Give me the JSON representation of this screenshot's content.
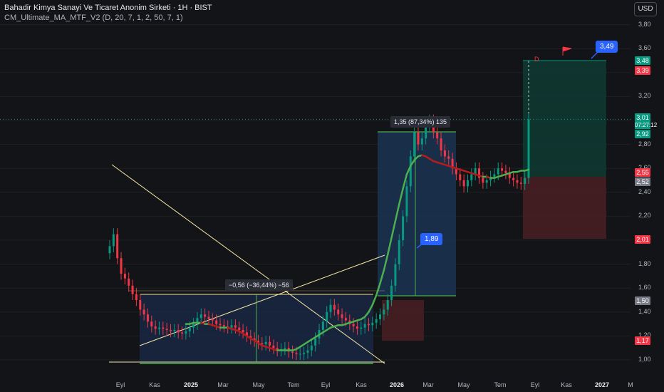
{
  "header": {
    "title": "Bahadir Kimya Sanayi Ve Ticaret Anonim Sirketi · 1H · BIST",
    "indicator": "CM_Ultimate_MA_MTF_V2 (D, 20, 7, 1, 2, 50, 7, 1)"
  },
  "currency": "USD",
  "price_tags": [
    {
      "value": "3,48",
      "color": "#089981"
    },
    {
      "value": "3,39",
      "color": "#f23645"
    },
    {
      "value": "3,01",
      "color": "#089981"
    },
    {
      "value": "2,92",
      "color": "#089981"
    },
    {
      "value": "2,55",
      "color": "#f23645"
    },
    {
      "value": "2,52",
      "color": "#787b86"
    },
    {
      "value": "2,01",
      "color": "#f23645"
    },
    {
      "value": "1,50",
      "color": "#787b86"
    },
    {
      "value": "1,17",
      "color": "#f23645"
    }
  ],
  "countdown": "07:27:12",
  "measure_labels": {
    "drop": "−0,56 (−36,44%) −56",
    "rise": "1,35 (87,34%) 135"
  },
  "callouts": {
    "low": "1,89",
    "high": "3,49"
  },
  "marker_d": "D",
  "colors": {
    "up": "#089981",
    "down": "#f23645",
    "ma_up": "#4caf50",
    "ma_down": "#b71c1c",
    "box_fill": "#1b2a4a",
    "line_yellow": "#f5e6a6"
  },
  "chart_data": {
    "type": "candlestick",
    "y_ticks": [
      "3,80",
      "3,60",
      "3,40",
      "3,20",
      "3,00",
      "2,80",
      "2,60",
      "2,40",
      "2,20",
      "2,00",
      "1,80",
      "1,60",
      "1,40",
      "1,20",
      "1,00"
    ],
    "ylim": [
      0.96,
      3.84
    ],
    "x_ticks": [
      {
        "label": "Eyl",
        "bold": false
      },
      {
        "label": "Kas",
        "bold": false
      },
      {
        "label": "2025",
        "bold": true
      },
      {
        "label": "Mar",
        "bold": false
      },
      {
        "label": "May",
        "bold": false
      },
      {
        "label": "Tem",
        "bold": false
      },
      {
        "label": "Eyl",
        "bold": false
      },
      {
        "label": "Kas",
        "bold": false
      },
      {
        "label": "2026",
        "bold": true
      },
      {
        "label": "Mar",
        "bold": false
      },
      {
        "label": "May",
        "bold": false
      },
      {
        "label": "Tem",
        "bold": false
      },
      {
        "label": "Eyl",
        "bold": false
      },
      {
        "label": "Kas",
        "bold": false
      },
      {
        "label": "2027",
        "bold": true
      },
      {
        "label": "M",
        "bold": false
      }
    ],
    "last_price": 3.01,
    "closes": [
      1.95,
      2.05,
      1.85,
      1.72,
      1.68,
      1.62,
      1.55,
      1.5,
      1.42,
      1.38,
      1.32,
      1.28,
      1.26,
      1.27,
      1.26,
      1.25,
      1.24,
      1.25,
      1.23,
      1.22,
      1.24,
      1.27,
      1.3,
      1.35,
      1.38,
      1.36,
      1.34,
      1.33,
      1.3,
      1.29,
      1.28,
      1.27,
      1.29,
      1.27,
      1.25,
      1.23,
      1.2,
      1.18,
      1.16,
      1.14,
      1.13,
      1.15,
      1.12,
      1.1,
      1.08,
      1.09,
      1.1,
      1.07,
      1.06,
      1.05,
      1.05,
      1.06,
      1.08,
      1.12,
      1.18,
      1.25,
      1.32,
      1.4,
      1.46,
      1.42,
      1.38,
      1.35,
      1.33,
      1.3,
      1.28,
      1.26,
      1.27,
      1.3,
      1.29,
      1.31,
      1.34,
      1.38,
      1.42,
      1.5,
      1.62,
      1.8,
      2.0,
      2.2,
      2.45,
      2.7,
      2.9,
      2.8,
      2.85,
      2.95,
      3.0,
      2.9,
      2.85,
      2.75,
      2.7,
      2.68,
      2.6,
      2.55,
      2.5,
      2.45,
      2.5,
      2.55,
      2.6,
      2.52,
      2.48,
      2.5,
      2.53,
      2.55,
      2.6,
      2.58,
      2.56,
      2.52,
      2.5,
      2.48,
      2.47,
      2.52,
      3.01
    ],
    "ma": [
      null,
      null,
      null,
      null,
      null,
      null,
      null,
      null,
      null,
      null,
      null,
      null,
      null,
      null,
      null,
      null,
      null,
      null,
      null,
      null,
      1.3,
      1.3,
      1.31,
      1.31,
      1.31,
      1.3,
      1.3,
      1.29,
      1.28,
      1.27,
      1.27,
      1.27,
      1.26,
      1.25,
      1.24,
      1.22,
      1.2,
      1.18,
      1.16,
      1.14,
      1.12,
      1.11,
      1.1,
      1.09,
      1.08,
      1.08,
      1.08,
      1.08,
      1.08,
      1.09,
      1.11,
      1.13,
      1.15,
      1.17,
      1.19,
      1.21,
      1.23,
      1.25,
      1.27,
      1.28,
      1.29,
      1.29,
      1.3,
      1.31,
      1.32,
      1.33,
      1.34,
      1.36,
      1.4,
      1.46,
      1.54,
      1.64,
      1.75,
      1.88,
      2.02,
      2.16,
      2.3,
      2.43,
      2.55,
      2.62,
      2.67,
      2.7,
      2.71,
      2.7,
      2.68,
      2.66,
      2.65,
      2.64,
      2.63,
      2.62,
      2.61,
      2.6,
      2.59,
      2.58,
      2.57,
      2.56,
      2.55,
      2.54,
      2.53,
      2.53,
      2.52,
      2.52,
      2.53,
      2.54,
      2.55,
      2.56,
      2.57,
      2.57,
      2.58,
      2.58,
      2.59
    ]
  }
}
